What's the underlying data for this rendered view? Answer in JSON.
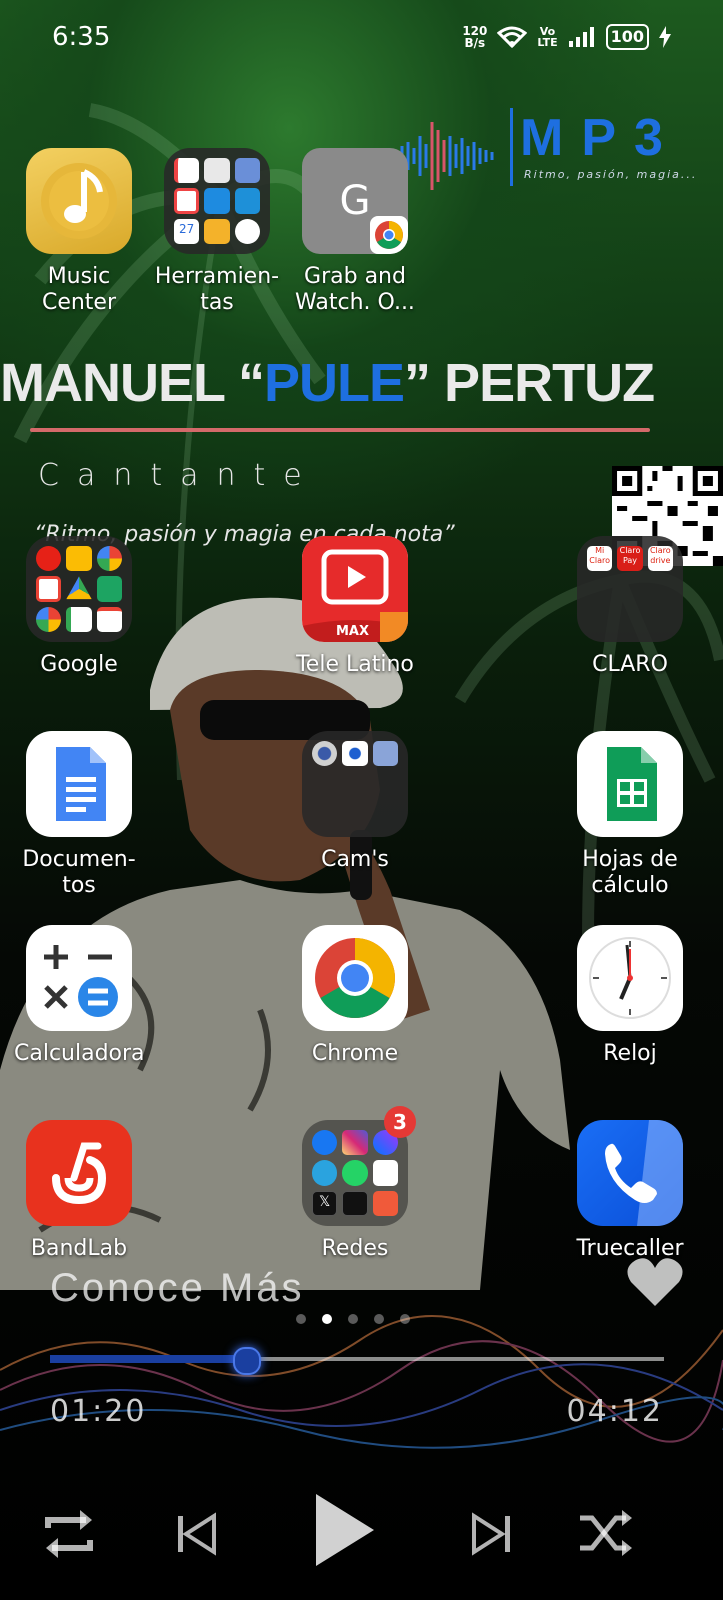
{
  "status_bar": {
    "time": "6:35",
    "net_speed_value": "120",
    "net_speed_unit": "B/s",
    "volte_top": "Vo",
    "volte_bottom": "LTE",
    "battery": "100"
  },
  "wallpaper": {
    "logo_text": "MP3",
    "logo_tagline": "Ritmo, pasión, magia...",
    "artist_prefix": "MANUEL “",
    "artist_highlight": "PULE",
    "artist_suffix": "” PERTUZ",
    "role": "Cantante",
    "slogan": "“Ritmo, pasión y magia en cada nota”"
  },
  "apps": [
    {
      "label": "Music\nCenter",
      "icon": "music-note-icon"
    },
    {
      "label": "Herramien-\ntas",
      "icon": "folder-icon"
    },
    {
      "label": "Grab and\nWatch. O...",
      "icon": "letter-g-icon",
      "letter": "G"
    },
    {
      "label": "Google",
      "icon": "folder-icon"
    },
    {
      "label": "Tele Latino",
      "icon": "tv-play-icon",
      "tag": "MAX"
    },
    {
      "label": "CLARO",
      "icon": "folder-icon"
    },
    {
      "label": "Documen-\ntos",
      "icon": "docs-icon"
    },
    {
      "label": "Cam's",
      "icon": "folder-icon"
    },
    {
      "label": "Hojas de\ncálculo",
      "icon": "sheets-icon"
    },
    {
      "label": "Calculadora",
      "icon": "calculator-icon"
    },
    {
      "label": "Chrome",
      "icon": "chrome-icon"
    },
    {
      "label": "Reloj",
      "icon": "clock-icon"
    },
    {
      "label": "BandLab",
      "icon": "bandlab-icon"
    },
    {
      "label": "Redes",
      "icon": "folder-icon",
      "badge": "3"
    },
    {
      "label": "Truecaller",
      "icon": "phone-icon"
    }
  ],
  "claro_folder": {
    "items": [
      "Mi Claro",
      "Claro Pay",
      "Claro drive"
    ]
  },
  "music_widget": {
    "heading": "Conoce Más",
    "elapsed": "01:20",
    "total": "04:12",
    "progress": 0.317,
    "page_count": 5,
    "active_page": 2
  },
  "colors": {
    "accent_blue": "#1e6fe0",
    "progress_blue": "#1a3fa0",
    "badge_red": "#e53935"
  }
}
